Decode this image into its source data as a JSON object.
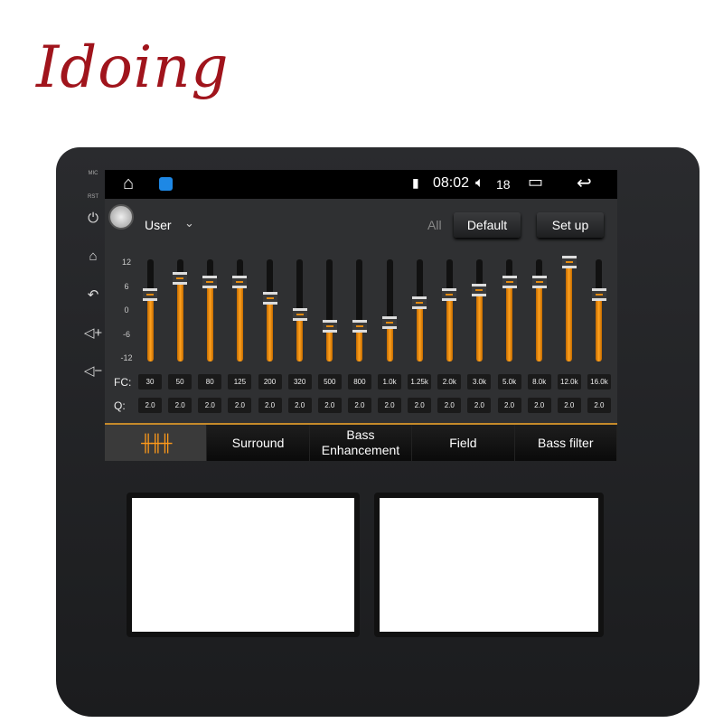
{
  "brand": {
    "logo": "Idoing",
    "color": "#a0141c"
  },
  "side_buttons": {
    "mic": "MIC",
    "rst": "RST",
    "icons": [
      "power-icon",
      "home-icon",
      "back-icon",
      "volume-up-icon",
      "volume-down-icon"
    ]
  },
  "status_bar": {
    "time": "08:02",
    "volume": "18",
    "icons": [
      "home-icon",
      "app-icon",
      "sim-unknown-icon",
      "volume-icon",
      "recent-apps-icon",
      "back-icon"
    ]
  },
  "toolbar": {
    "preset": "User",
    "all_label": "All",
    "default_label": "Default",
    "setup_label": "Set up"
  },
  "eq": {
    "accent": "#ff9a1a",
    "axis_labels": [
      "12",
      "6",
      "0",
      "-6",
      "-12"
    ],
    "range_db": [
      -12,
      12
    ],
    "fc_label": "FC:",
    "q_label": "Q:",
    "bands": [
      {
        "fc": "30",
        "q": "2.0",
        "gain": 4
      },
      {
        "fc": "50",
        "q": "2.0",
        "gain": 8
      },
      {
        "fc": "80",
        "q": "2.0",
        "gain": 7
      },
      {
        "fc": "125",
        "q": "2.0",
        "gain": 7
      },
      {
        "fc": "200",
        "q": "2.0",
        "gain": 3
      },
      {
        "fc": "320",
        "q": "2.0",
        "gain": -1
      },
      {
        "fc": "500",
        "q": "2.0",
        "gain": -4
      },
      {
        "fc": "800",
        "q": "2.0",
        "gain": -4
      },
      {
        "fc": "1.0k",
        "q": "2.0",
        "gain": -3
      },
      {
        "fc": "1.25k",
        "q": "2.0",
        "gain": 2
      },
      {
        "fc": "2.0k",
        "q": "2.0",
        "gain": 4
      },
      {
        "fc": "3.0k",
        "q": "2.0",
        "gain": 5
      },
      {
        "fc": "5.0k",
        "q": "2.0",
        "gain": 7
      },
      {
        "fc": "8.0k",
        "q": "2.0",
        "gain": 7
      },
      {
        "fc": "12.0k",
        "q": "2.0",
        "gain": 12
      },
      {
        "fc": "16.0k",
        "q": "2.0",
        "gain": 4
      }
    ]
  },
  "tabs": [
    {
      "label": "",
      "icon": "equalizer-icon",
      "active": true
    },
    {
      "label": "Surround"
    },
    {
      "label": "Bass\nEnhancement"
    },
    {
      "label": "Field"
    },
    {
      "label": "Bass filter"
    }
  ]
}
